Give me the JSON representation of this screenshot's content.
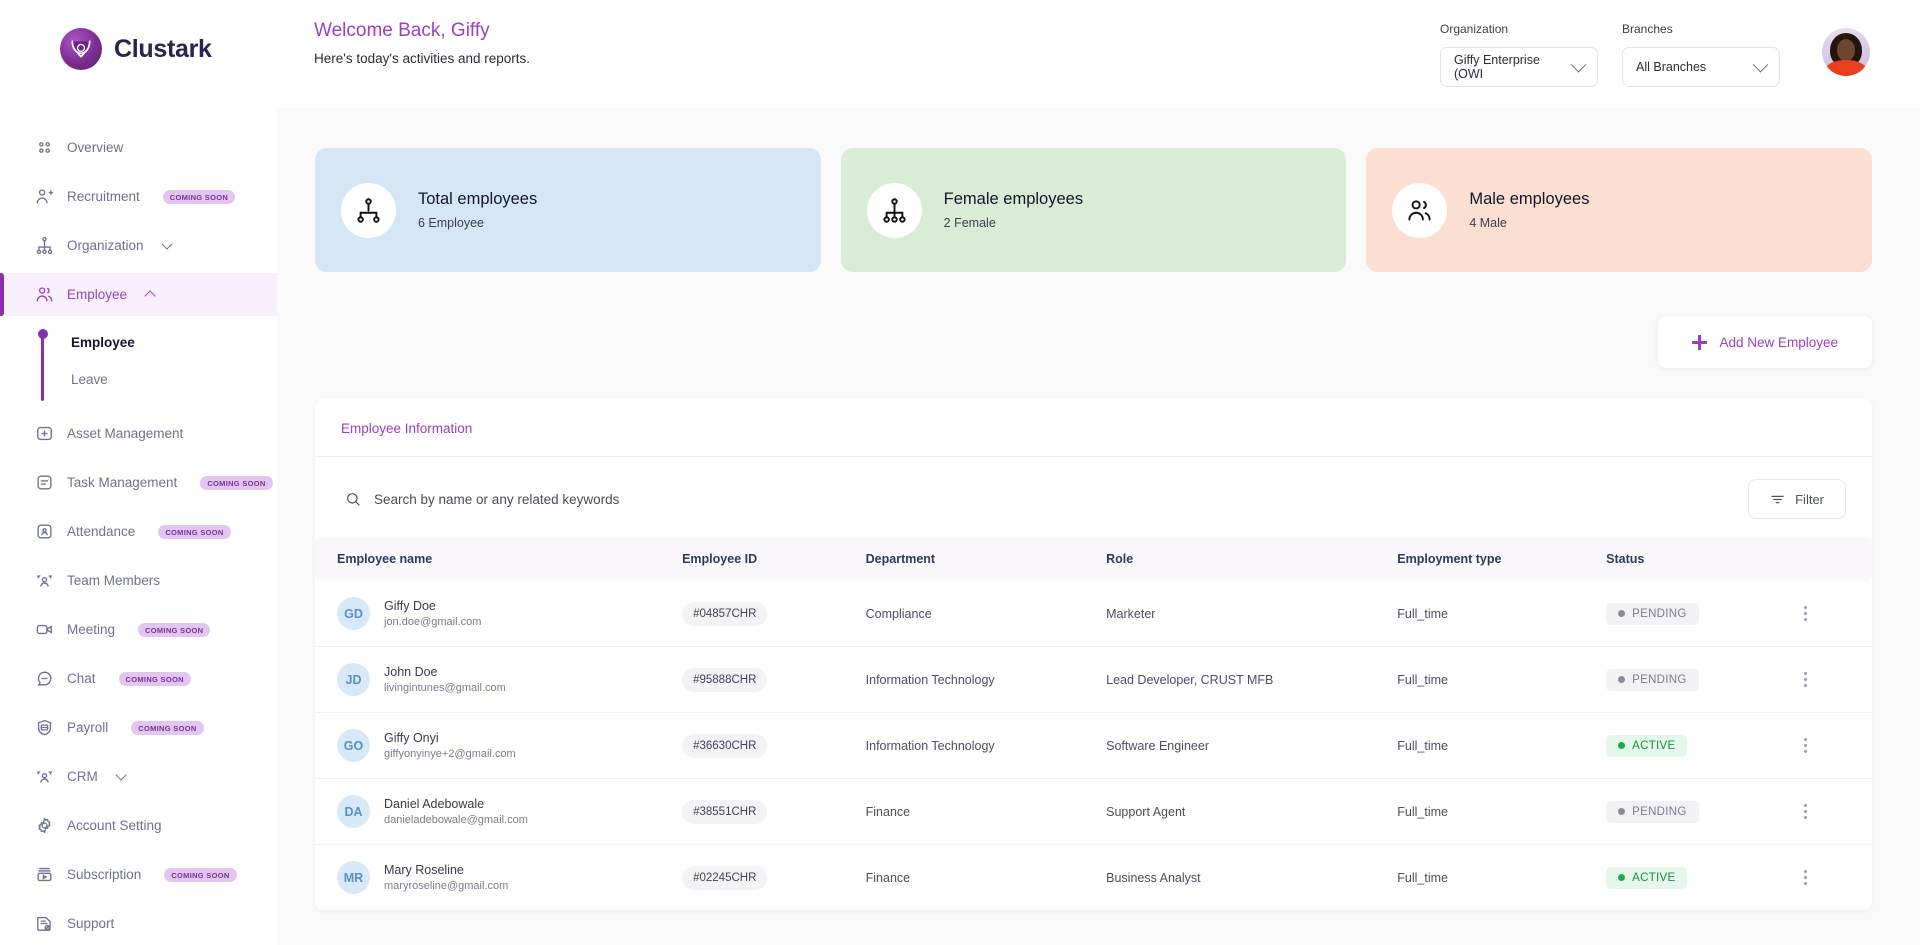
{
  "brand": {
    "name": "Clustark"
  },
  "header": {
    "welcome_title": "Welcome Back, Giffy",
    "welcome_subtitle": "Here's today's activities and reports.",
    "organization_label": "Organization",
    "organization_value": "Giffy Enterprise (OWI",
    "branches_label": "Branches",
    "branches_value": "All Branches"
  },
  "sidebar": {
    "items": [
      {
        "label": "Overview",
        "icon": "grid-dots-icon",
        "badge": "",
        "caret": "",
        "active": false
      },
      {
        "label": "Recruitment",
        "icon": "user-plus-icon",
        "badge": "COMING SOON",
        "caret": "",
        "active": false
      },
      {
        "label": "Organization",
        "icon": "org-chart-icon",
        "badge": "",
        "caret": "down",
        "active": false
      },
      {
        "label": "Employee",
        "icon": "users-icon",
        "badge": "",
        "caret": "up",
        "active": true
      },
      {
        "label": "Asset Management",
        "icon": "asset-box-icon",
        "badge": "",
        "caret": "",
        "active": false
      },
      {
        "label": "Task Management",
        "icon": "task-list-icon",
        "badge": "COMING SOON",
        "caret": "",
        "active": false
      },
      {
        "label": "Attendance",
        "icon": "attendance-icon",
        "badge": "COMING SOON",
        "caret": "",
        "active": false
      },
      {
        "label": "Team Members",
        "icon": "team-icon",
        "badge": "",
        "caret": "",
        "active": false
      },
      {
        "label": "Meeting",
        "icon": "video-camera-icon",
        "badge": "COMING SOON",
        "caret": "",
        "active": false
      },
      {
        "label": "Chat",
        "icon": "chat-bubble-icon",
        "badge": "COMING SOON",
        "caret": "",
        "active": false
      },
      {
        "label": "Payroll",
        "icon": "payroll-card-icon",
        "badge": "COMING SOON",
        "caret": "",
        "active": false
      },
      {
        "label": "CRM",
        "icon": "team-icon",
        "badge": "",
        "caret": "down",
        "active": false
      },
      {
        "label": "Account Setting",
        "icon": "gear-icon",
        "badge": "",
        "caret": "",
        "active": false
      },
      {
        "label": "Subscription",
        "icon": "subscription-icon",
        "badge": "COMING SOON",
        "caret": "",
        "active": false
      },
      {
        "label": "Support",
        "icon": "support-doc-icon",
        "badge": "",
        "caret": "",
        "active": false
      }
    ],
    "sub_items": [
      {
        "label": "Employee",
        "current": true
      },
      {
        "label": "Leave",
        "current": false
      }
    ]
  },
  "stats": [
    {
      "title": "Total employees",
      "sub": "6 Employee",
      "bg": "#d5e7f5",
      "icon": "org-node-icon"
    },
    {
      "title": "Female employees",
      "sub": "2 Female",
      "bg": "#d9ecd5",
      "icon": "org-chart-icon"
    },
    {
      "title": "Male employees",
      "sub": "4 Male",
      "bg": "#fbdfd1",
      "icon": "users-icon"
    }
  ],
  "actions": {
    "add_employee": "Add New Employee"
  },
  "panel": {
    "title": "Employee Information",
    "search_placeholder": "Search by name or any related keywords",
    "search_value": "",
    "filter_label": "Filter"
  },
  "table": {
    "columns": [
      "Employee name",
      "Employee ID",
      "Department",
      "Role",
      "Employment type",
      "Status"
    ],
    "rows": [
      {
        "initials": "GD",
        "name": "Giffy Doe",
        "email": "jon.doe@gmail.com",
        "id": "#04857CHR",
        "department": "Compliance",
        "role": "Marketer",
        "employment": "Full_time",
        "status": "PENDING",
        "status_kind": "pending"
      },
      {
        "initials": "JD",
        "name": "John Doe",
        "email": "livingintunes@gmail.com",
        "id": "#95888CHR",
        "department": "Information Technology",
        "role": "Lead Developer, CRUST MFB",
        "employment": "Full_time",
        "status": "PENDING",
        "status_kind": "pending"
      },
      {
        "initials": "GO",
        "name": "Giffy Onyi",
        "email": "giffyonyinye+2@gmail.com",
        "id": "#36630CHR",
        "department": "Information Technology",
        "role": "Software Engineer",
        "employment": "Full_time",
        "status": "ACTIVE",
        "status_kind": "active"
      },
      {
        "initials": "DA",
        "name": "Daniel Adebowale",
        "email": "danieladebowale@gmail.com",
        "id": "#38551CHR",
        "department": "Finance",
        "role": "Support Agent",
        "employment": "Full_time",
        "status": "PENDING",
        "status_kind": "pending"
      },
      {
        "initials": "MR",
        "name": "Mary Roseline",
        "email": "maryroseline@gmail.com",
        "id": "#02245CHR",
        "department": "Finance",
        "role": "Business Analyst",
        "employment": "Full_time",
        "status": "ACTIVE",
        "status_kind": "active"
      }
    ]
  },
  "colors": {
    "brand_purple": "#9b3fbf",
    "accent_dark": "#8b2fb0",
    "active_green": "#1fa74f",
    "pending_grey": "#8b8b9b"
  }
}
